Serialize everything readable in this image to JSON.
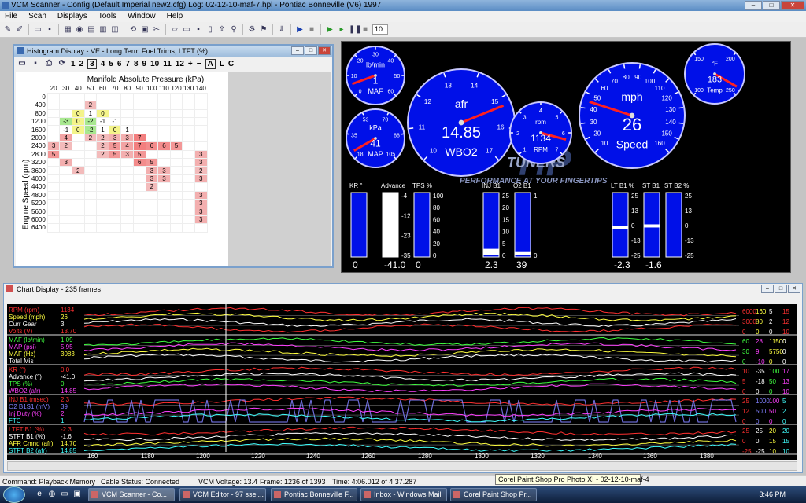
{
  "app": {
    "title": "VCM Scanner - Config (Default Imperial new2.cfg)  Log: 02-12-10-maf-7.hpl  - Pontiac Bonneville (V6) 1997",
    "menu": [
      "File",
      "Scan",
      "Displays",
      "Tools",
      "Window",
      "Help"
    ],
    "toolbar_value": "10"
  },
  "histogram": {
    "title": "Histogram Display  -  VE - Long Term Fuel Trims, LTFT  (%)",
    "tools": [
      "1",
      "2",
      "3",
      "4",
      "5",
      "6",
      "7",
      "8",
      "9",
      "10",
      "11",
      "12",
      "+",
      "−",
      "A",
      "L",
      "C"
    ],
    "x_axis_label": "Manifold Absolute Pressure (kPa)",
    "y_axis_label": "Engine Speed (rpm)",
    "columns": [
      "20",
      "30",
      "40",
      "50",
      "60",
      "70",
      "80",
      "90",
      "100",
      "110",
      "120",
      "130",
      "140"
    ],
    "rows": [
      {
        "rpm": "0",
        "cells": [
          "",
          "",
          "",
          "",
          "",
          "",
          "",
          "",
          "",
          "",
          "",
          "",
          ""
        ]
      },
      {
        "rpm": "400",
        "cells": [
          "",
          "",
          "",
          "2",
          "",
          "",
          "",
          "",
          "",
          "",
          "",
          "",
          ""
        ]
      },
      {
        "rpm": "800",
        "cells": [
          "",
          "",
          "0",
          "1",
          "0",
          "",
          "",
          "",
          "",
          "",
          "",
          "",
          ""
        ]
      },
      {
        "rpm": "1200",
        "cells": [
          "",
          "-3",
          "0",
          "-2",
          "-1",
          "-1",
          "",
          "",
          "",
          "",
          "",
          "",
          ""
        ]
      },
      {
        "rpm": "1600",
        "cells": [
          "",
          "-1",
          "0",
          "-2",
          "1",
          "0",
          "1",
          "",
          "",
          "",
          "",
          "",
          ""
        ]
      },
      {
        "rpm": "2000",
        "cells": [
          "",
          "4",
          "",
          "2",
          "2",
          "3",
          "3",
          "7",
          "",
          "",
          "",
          "",
          ""
        ]
      },
      {
        "rpm": "2400",
        "cells": [
          "3",
          "2",
          "",
          "",
          "2",
          "5",
          "4",
          "7",
          "6",
          "6",
          "5",
          "",
          ""
        ]
      },
      {
        "rpm": "2800",
        "cells": [
          "5",
          "",
          "",
          "",
          "2",
          "5",
          "3",
          "5",
          "",
          "",
          "",
          "",
          "3"
        ]
      },
      {
        "rpm": "3200",
        "cells": [
          "",
          "3",
          "",
          "",
          "",
          "",
          "",
          "6",
          "5",
          "",
          "",
          "",
          "3"
        ]
      },
      {
        "rpm": "3600",
        "cells": [
          "",
          "",
          "2",
          "",
          "",
          "",
          "",
          "",
          "3",
          "3",
          "",
          "",
          "2"
        ]
      },
      {
        "rpm": "4000",
        "cells": [
          "",
          "",
          "",
          "",
          "",
          "",
          "",
          "",
          "3",
          "3",
          "",
          "",
          "3"
        ]
      },
      {
        "rpm": "4400",
        "cells": [
          "",
          "",
          "",
          "",
          "",
          "",
          "",
          "",
          "2",
          "",
          "",
          "",
          ""
        ]
      },
      {
        "rpm": "4800",
        "cells": [
          "",
          "",
          "",
          "",
          "",
          "",
          "",
          "",
          "",
          "",
          "",
          "",
          "3"
        ]
      },
      {
        "rpm": "5200",
        "cells": [
          "",
          "",
          "",
          "",
          "",
          "",
          "",
          "",
          "",
          "",
          "",
          "",
          "3"
        ]
      },
      {
        "rpm": "5600",
        "cells": [
          "",
          "",
          "",
          "",
          "",
          "",
          "",
          "",
          "",
          "",
          "",
          "",
          "3"
        ]
      },
      {
        "rpm": "6000",
        "cells": [
          "",
          "",
          "",
          "",
          "",
          "",
          "",
          "",
          "",
          "",
          "",
          "",
          "3"
        ]
      },
      {
        "rpm": "6400",
        "cells": [
          "",
          "",
          "",
          "",
          "",
          "",
          "",
          "",
          "",
          "",
          "",
          "",
          ""
        ]
      }
    ]
  },
  "gauges": {
    "maf": {
      "label": "MAF",
      "unit": "lb/min",
      "value": "1",
      "ticks": [
        "0",
        "10",
        "20",
        "30",
        "40",
        "50",
        "60"
      ]
    },
    "map": {
      "label": "MAP",
      "unit": "kPa",
      "value": "41",
      "ticks": [
        "18",
        "35",
        "53",
        "70",
        "88",
        "105"
      ]
    },
    "afr": {
      "label": "WBO2",
      "unit": "afr",
      "value": "14.85",
      "ticks": [
        "10",
        "11",
        "12",
        "13",
        "14",
        "15",
        "16",
        "17"
      ]
    },
    "rpm": {
      "label": "RPM",
      "unit": "rpm",
      "value": "1134",
      "ticks": [
        "1",
        "2",
        "3",
        "4",
        "5",
        "6",
        "7"
      ]
    },
    "mph": {
      "label": "Speed",
      "unit": "mph",
      "value": "26",
      "ticks": [
        "10",
        "20",
        "30",
        "40",
        "50",
        "60",
        "70",
        "80",
        "90",
        "100",
        "110",
        "120",
        "130",
        "140",
        "150",
        "160"
      ]
    },
    "temp": {
      "label": "Temp",
      "unit": "°F",
      "value": "183",
      "ticks": [
        "100",
        "150",
        "200",
        "250"
      ]
    },
    "brand": "TUNERS",
    "tagline": "PERFORMANCE AT YOUR FINGERTIPS",
    "bars": [
      {
        "label": "KR °",
        "value": "0",
        "ticks": [],
        "fill": 0.0
      },
      {
        "label": "Advance",
        "value": "-41.0",
        "ticks": [
          "-4",
          "-12",
          "-23",
          "-35"
        ],
        "fill": 1.0,
        "white": true
      },
      {
        "label": "TPS %",
        "value": "0",
        "ticks": [
          "100",
          "80",
          "60",
          "40",
          "20",
          "0"
        ],
        "fill": 0.0
      },
      {
        "label": "INJ B1",
        "value": "2.3",
        "ticks": [
          "25",
          "20",
          "15",
          "10",
          "5",
          "0"
        ],
        "fill": 0.09
      },
      {
        "label": "O2 B1",
        "value": "39",
        "ticks": [
          "1",
          "0"
        ],
        "fill": 0.04
      },
      {
        "label": "LT B1 %",
        "value": "-2.3",
        "ticks": [
          "25",
          "13",
          "0",
          "-13",
          "-25"
        ],
        "fill": 0.45
      },
      {
        "label": "ST B1",
        "value": "-1.6",
        "ticks": [],
        "fill": 0.47
      },
      {
        "label": "ST B2 %",
        "value": "",
        "ticks": [
          "25",
          "13",
          "0",
          "-13",
          "-25"
        ],
        "fill": 0.0
      }
    ]
  },
  "chart": {
    "title": "Chart Display  -  235 frames",
    "groups": [
      {
        "labels": [
          [
            "RPM (rpm)",
            "1134",
            "#ff3030"
          ],
          [
            "Speed (mph)",
            "26",
            "#ffff40"
          ],
          [
            "Curr Gear",
            "3",
            "#ffffff"
          ],
          [
            "Volts (V)",
            "13.70",
            "#ff3030"
          ]
        ],
        "scale": [
          [
            "6000",
            "160",
            "5",
            "15"
          ],
          [
            "3000",
            "80",
            "2",
            "12"
          ],
          [
            "0",
            "0",
            "0",
            "10"
          ]
        ],
        "scale_colors": [
          "#ff3030",
          "#ffff40",
          "#ffffff",
          "#ff3030"
        ]
      },
      {
        "labels": [
          [
            "MAF (lb/min)",
            "1.09",
            "#40ff40"
          ],
          [
            "MAP (psi)",
            "5.95",
            "#ff40ff"
          ],
          [
            "MAF (Hz)",
            "3083",
            "#ffff40"
          ],
          [
            "Total Mis",
            "",
            "#ffffff"
          ]
        ],
        "scale": [
          [
            "60",
            "28",
            "11500",
            "0"
          ],
          [
            "30",
            "9",
            "5750",
            "0"
          ],
          [
            "0",
            "-10",
            "0",
            "0"
          ]
        ],
        "scale_colors": [
          "#40ff40",
          "#ff40ff",
          "#ffff40",
          "#ffffff"
        ]
      },
      {
        "labels": [
          [
            "KR (°)",
            "0.0",
            "#ff3030"
          ],
          [
            "Advance (°)",
            "-41.0",
            "#ffffff"
          ],
          [
            "TPS (%)",
            "0",
            "#40ff40"
          ],
          [
            "WBO2 (afr)",
            "14.85",
            "#ff40ff"
          ]
        ],
        "scale": [
          [
            "10",
            "-35",
            "100",
            "17"
          ],
          [
            "5",
            "-18",
            "50",
            "13"
          ],
          [
            "0",
            "0",
            "0",
            "10"
          ]
        ],
        "scale_colors": [
          "#ff3030",
          "#ffffff",
          "#40ff40",
          "#ff40ff"
        ]
      },
      {
        "labels": [
          [
            "INJ B1 (msec)",
            "2.3",
            "#ff3030"
          ],
          [
            "O2 B1S1 (mV)",
            "39",
            "#8080ff"
          ],
          [
            "Inj Duty (%)",
            "2",
            "#ff40ff"
          ],
          [
            "FTC",
            "1",
            "#40ffff"
          ]
        ],
        "scale": [
          [
            "25",
            "1000",
            "100",
            "5"
          ],
          [
            "12",
            "500",
            "50",
            "2"
          ],
          [
            "0",
            "0",
            "0",
            "0"
          ]
        ],
        "scale_colors": [
          "#ff3030",
          "#8080ff",
          "#ff40ff",
          "#40ffff"
        ]
      },
      {
        "labels": [
          [
            "LTFT B1 (%)",
            "-2.3",
            "#ff3030"
          ],
          [
            "STFT B1 (%)",
            "-1.6",
            "#ffffff"
          ],
          [
            "AFR Cmnd (afr)",
            "14.70",
            "#ffff40"
          ],
          [
            "STFT B2 (afr)",
            "14.85",
            "#40ffff"
          ]
        ],
        "scale": [
          [
            "25",
            "25",
            "20",
            "20"
          ],
          [
            "0",
            "0",
            "15",
            "15"
          ],
          [
            "-25",
            "-25",
            "10",
            "10"
          ]
        ],
        "scale_colors": [
          "#ff3030",
          "#ffffff",
          "#ffff40",
          "#40ffff"
        ]
      }
    ],
    "x_ticks": [
      "160",
      "1180",
      "1200",
      "1220",
      "1240",
      "1260",
      "1280",
      "1300",
      "1320",
      "1340",
      "1360",
      "1380"
    ]
  },
  "status": {
    "command": "Command:  Playback Memory",
    "cable": "Cable Status:  Connected",
    "voltage": "VCM Voltage:  13.4",
    "frame": "Frame:  1236 of 1393",
    "time": "Time:  4:06.012 of 4:37.287",
    "tooltip": "Corel Paint Shop Pro Photo XI - 02-12-10-maf-4"
  },
  "taskbar": {
    "tasks": [
      "VCM Scanner - Co...",
      "VCM Editor - 97 ssei...",
      "Pontiac Bonneville F...",
      "Inbox - Windows Mail",
      "Corel Paint Shop Pr..."
    ],
    "clock": "3:46 PM"
  },
  "colors": {
    "gauge_blue": "#0010e8",
    "gauge_bg": "#000000",
    "accent_red": "#ff2020"
  }
}
